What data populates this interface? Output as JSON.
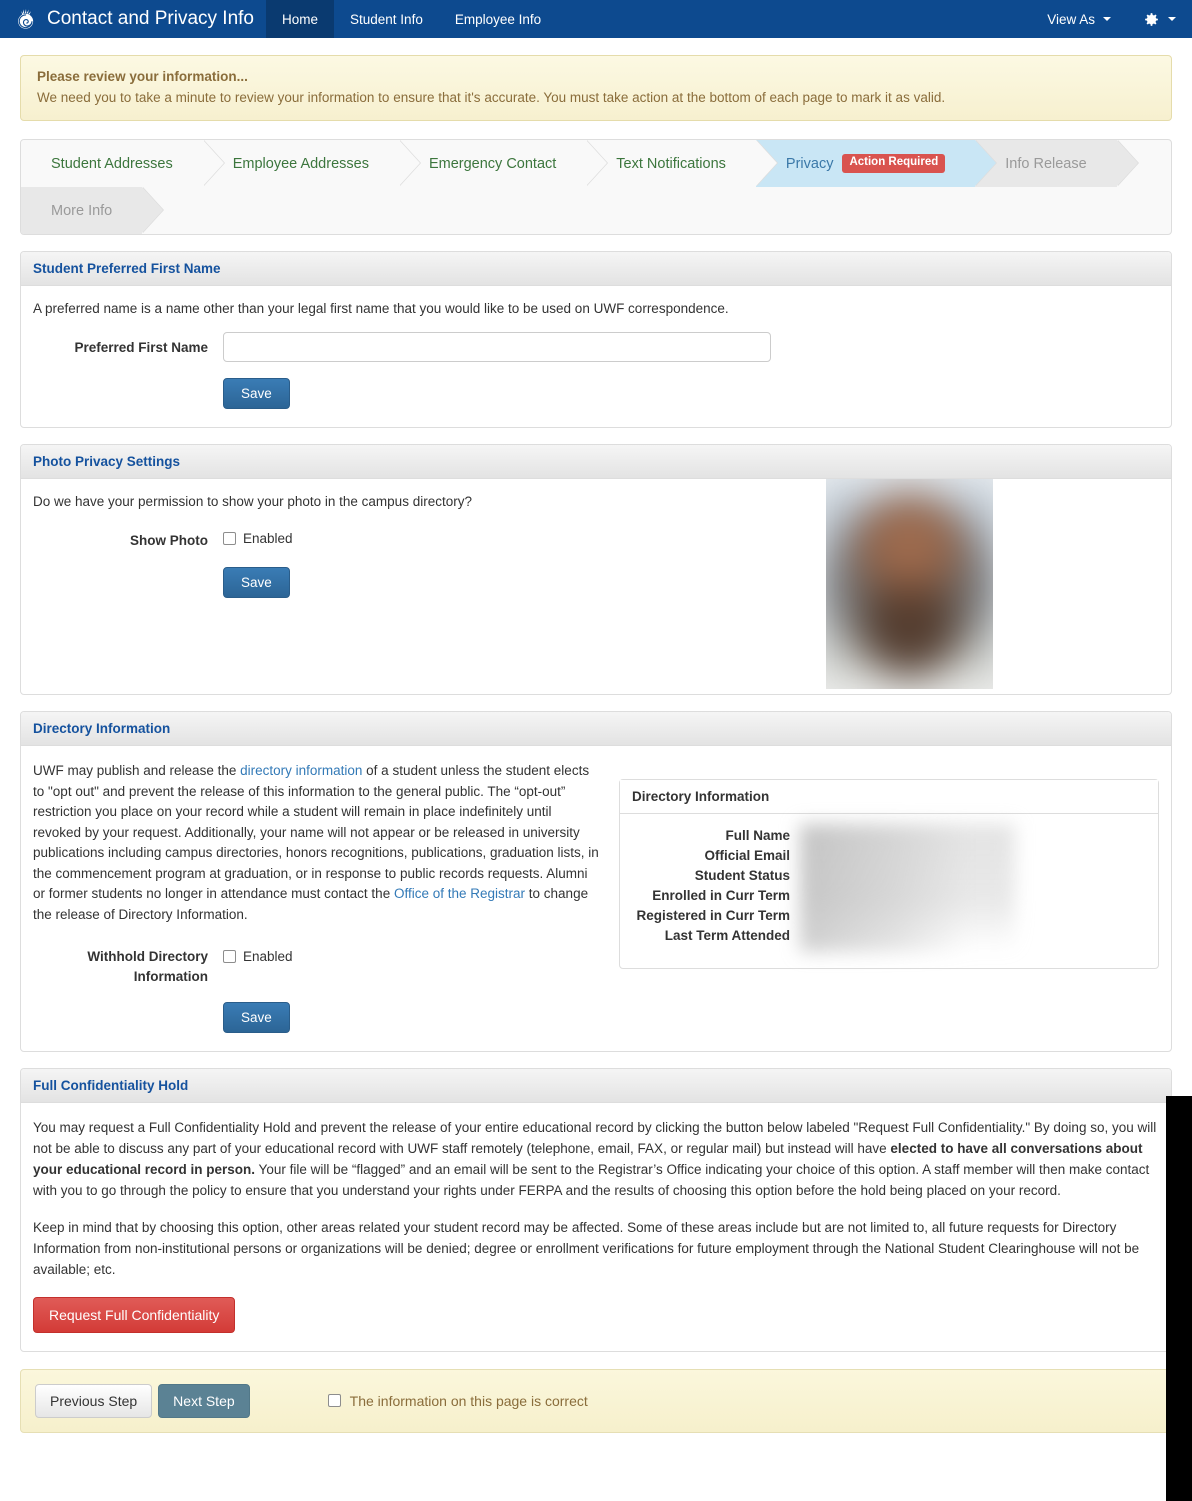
{
  "navbar": {
    "brand": "Contact and Privacy Info",
    "logo_icon": "nautilus-shell-logo",
    "items": [
      {
        "label": "Home",
        "active": true
      },
      {
        "label": "Student Info",
        "active": false
      },
      {
        "label": "Employee Info",
        "active": false
      }
    ],
    "view_as": "View As",
    "gear_icon": "gear-icon",
    "brand_color": "#0d4a8f",
    "active_color": "#0a3a70"
  },
  "alert": {
    "title": "Please review your information...",
    "text": "We need you to take a minute to review your information to ensure that it's accurate. You must take action at the bottom of each page to mark it as valid.",
    "bg_color": "#fcf9e3",
    "text_color": "#8a6d3b"
  },
  "wizard": {
    "steps": [
      {
        "label": "Student Addresses",
        "state": "complete"
      },
      {
        "label": "Employee Addresses",
        "state": "complete"
      },
      {
        "label": "Emergency Contact",
        "state": "complete"
      },
      {
        "label": "Text Notifications",
        "state": "complete"
      },
      {
        "label": "Privacy",
        "state": "active",
        "badge": "Action Required"
      },
      {
        "label": "Info Release",
        "state": "pending"
      },
      {
        "label": "More Info",
        "state": "pending"
      }
    ],
    "badge_color": "#d9534f",
    "active_color": "#c9e6f5"
  },
  "preferred_name": {
    "panel_title": "Student Preferred First Name",
    "description": "A preferred name is a name other than your legal first name that you would like to be used on UWF correspondence.",
    "field_label": "Preferred First Name",
    "field_value": "",
    "field_placeholder": "",
    "save_label": "Save"
  },
  "photo_privacy": {
    "panel_title": "Photo Privacy Settings",
    "description": "Do we have your permission to show your photo in the campus directory?",
    "field_label": "Show Photo",
    "checkbox_label": "Enabled",
    "checked": false,
    "save_label": "Save",
    "photo_alt": "student-photo-blurred"
  },
  "directory": {
    "panel_title": "Directory Information",
    "paragraph_part1": "UWF may publish and release the ",
    "link1": "directory information",
    "paragraph_part2": " of a student unless the student elects to \"opt out\" and prevent the release of this information to the general public. The “opt-out” restriction you place on your record while a student will remain in place indefinitely until revoked by your request.  Additionally, your name will not appear or be released in university publications including campus directories, honors recognitions, publications, graduation lists, in the commencement program at graduation, or in response to public records requests.  Alumni or former students no longer in attendance must contact the ",
    "link2": "Office of the Registrar",
    "paragraph_part3": " to change the release of Directory Information.",
    "field_label": "Withhold Directory Information",
    "checkbox_label": "Enabled",
    "checked": false,
    "save_label": "Save",
    "card_title": "Directory Information",
    "card_rows": [
      {
        "key": "Full Name",
        "value": ""
      },
      {
        "key": "Official Email",
        "value": ""
      },
      {
        "key": "Student Status",
        "value": ""
      },
      {
        "key": "Enrolled in Curr Term",
        "value": ""
      },
      {
        "key": "Registered in Curr Term",
        "value": ""
      },
      {
        "key": "Last Term Attended",
        "value": ""
      }
    ]
  },
  "confidentiality": {
    "panel_title": "Full Confidentiality Hold",
    "para1_a": "You may request a Full Confidentiality Hold and prevent the release of your entire educational record by clicking the button below labeled \"Request Full Confidentiality.\"  By doing so, you will not be able to discuss any part of your educational record with UWF staff remotely (telephone, email, FAX, or regular mail) but instead will have ",
    "para1_bold": "elected to have all conversations about your educational record in person.",
    "para1_b": "  Your file will be “flagged” and an email will be sent to the Registrar’s Office indicating your choice of this option.  A staff member will then make contact with you to go through the policy to ensure that you understand your rights under FERPA and the results of choosing this option before the hold being placed on your record.",
    "para2": "Keep in mind that by choosing this option, other areas related your student record may be affected. Some of these areas include but are not limited to, all future requests for Directory Information from non-institutional persons or organizations will be denied; degree or enrollment verifications for future employment through the National Student Clearinghouse will not be available; etc.",
    "request_label": "Request Full Confidentiality",
    "request_color": "#d9534f"
  },
  "footer": {
    "previous_label": "Previous Step",
    "next_label": "Next Step",
    "checkbox_label": "The information on this page is correct",
    "checked": false
  }
}
